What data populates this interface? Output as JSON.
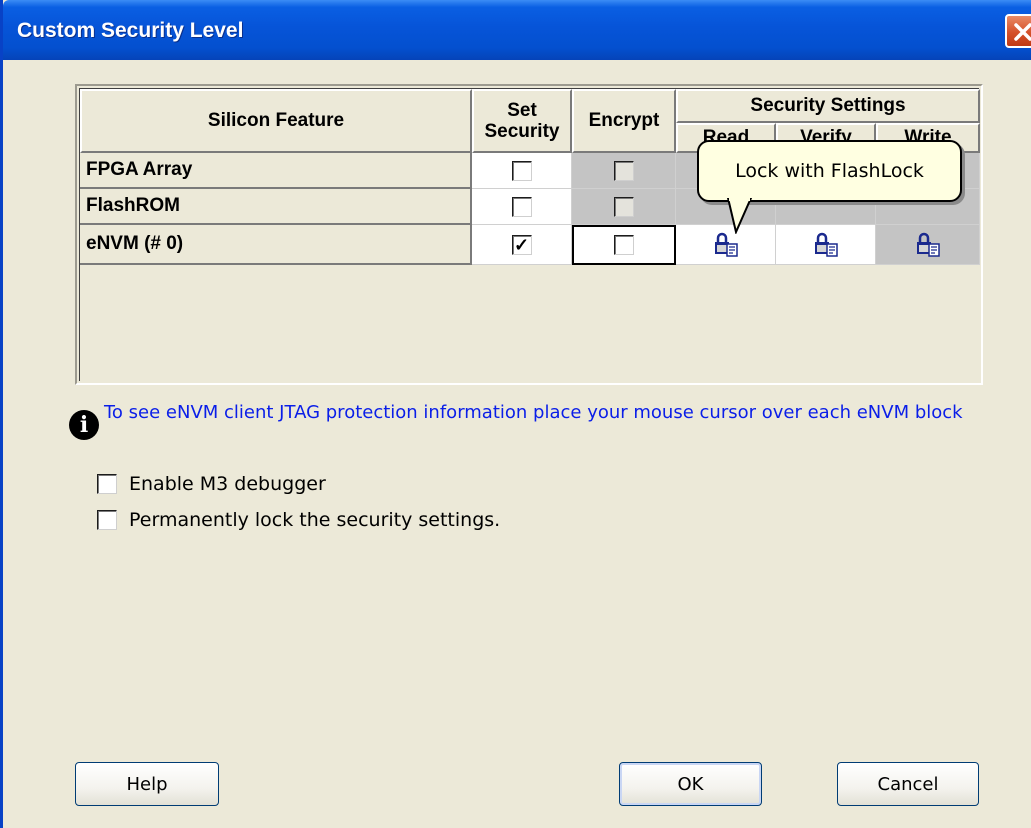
{
  "window": {
    "title": "Custom Security Level",
    "close_icon": "close-icon"
  },
  "table": {
    "headers": {
      "feature": "Silicon Feature",
      "set_security_line1": "Set",
      "set_security_line2": "Security",
      "encrypt": "Encrypt",
      "security_settings": "Security Settings",
      "read": "Read",
      "verify": "Verify",
      "write": "Write"
    },
    "rows": [
      {
        "name": "FPGA Array",
        "set_security": false,
        "encrypt": false
      },
      {
        "name": "FlashROM",
        "set_security": false,
        "encrypt": false
      },
      {
        "name": "eNVM (# 0)",
        "set_security": true,
        "encrypt": false
      }
    ]
  },
  "tooltip": {
    "text": "Lock with FlashLock"
  },
  "info": {
    "icon": "info-icon",
    "text": "To see eNVM client JTAG protection information place your mouse cursor over each eNVM block"
  },
  "options": [
    {
      "label": "Enable M3 debugger",
      "checked": false
    },
    {
      "label": "Permanently lock the security settings.",
      "checked": false
    }
  ],
  "buttons": {
    "help": "Help",
    "ok": "OK",
    "cancel": "Cancel"
  }
}
